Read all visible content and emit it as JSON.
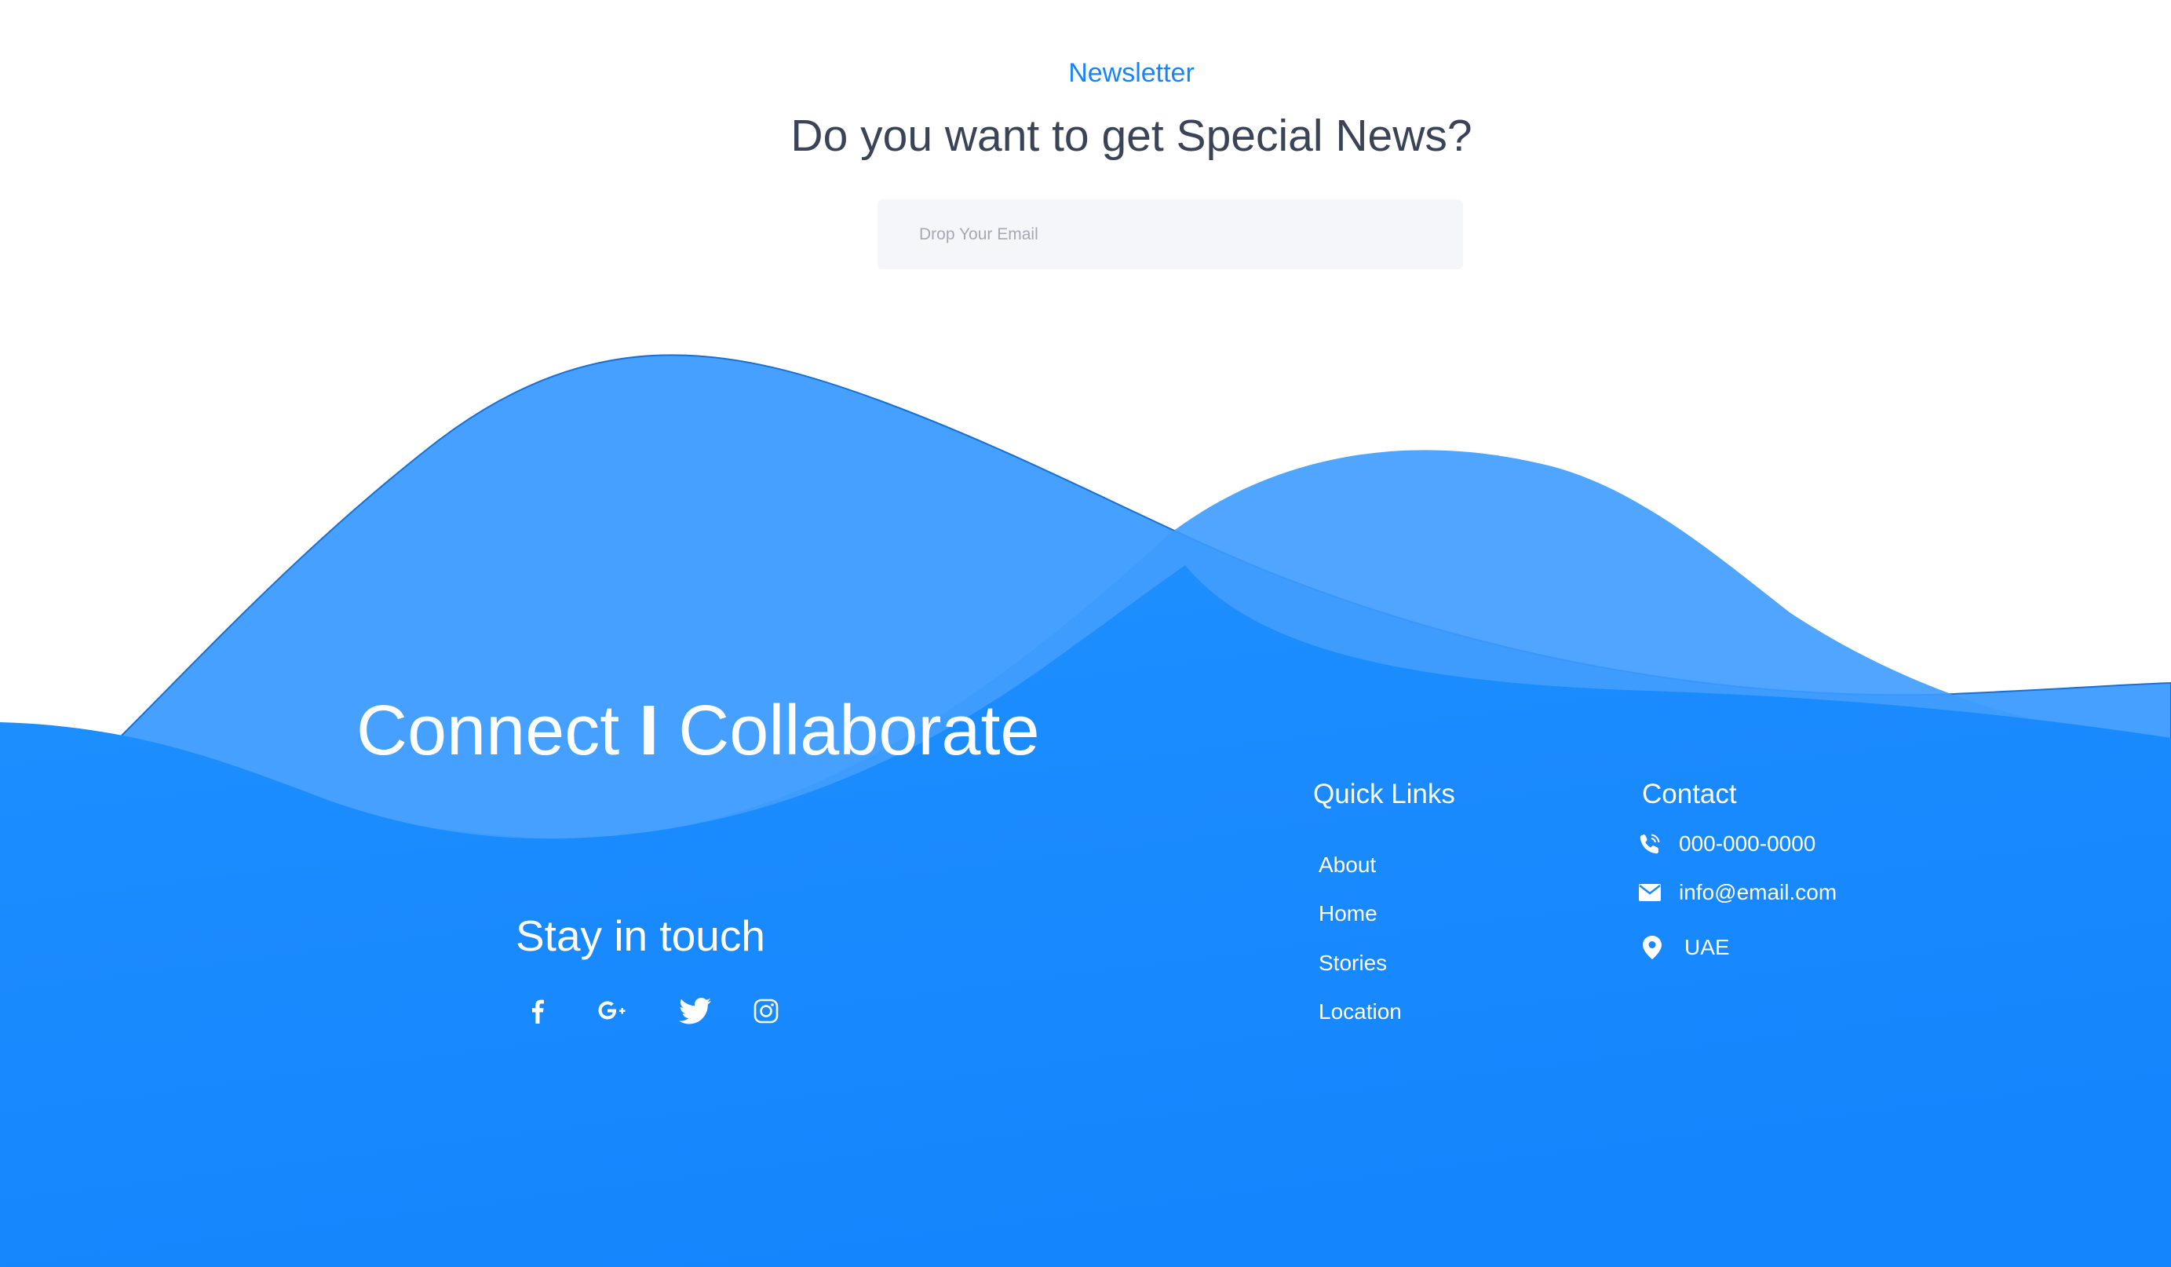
{
  "newsletter": {
    "label": "Newsletter",
    "heading": "Do you want to get Special News?",
    "email_placeholder": "Drop Your Email"
  },
  "footer": {
    "brand_left": "Connect",
    "brand_sep": "I",
    "brand_right": "Collaborate",
    "stay_in_touch": "Stay in touch",
    "social_icons": [
      "facebook-icon",
      "google-plus-icon",
      "twitter-icon",
      "instagram-icon"
    ],
    "quick_links": {
      "title": "Quick Links",
      "items": [
        "About",
        "Home",
        "Stories",
        "Location"
      ]
    },
    "contact": {
      "title": "Contact",
      "phone": "000-000-0000",
      "email": "info@email.com",
      "location": "UAE"
    }
  },
  "colors": {
    "accent": "#1685fb",
    "heading_text": "#3a4459",
    "wave_light": "#43a0ff",
    "wave_main": "#1a8cff",
    "input_bg": "#f5f6f9",
    "placeholder": "#a3a9b5"
  }
}
